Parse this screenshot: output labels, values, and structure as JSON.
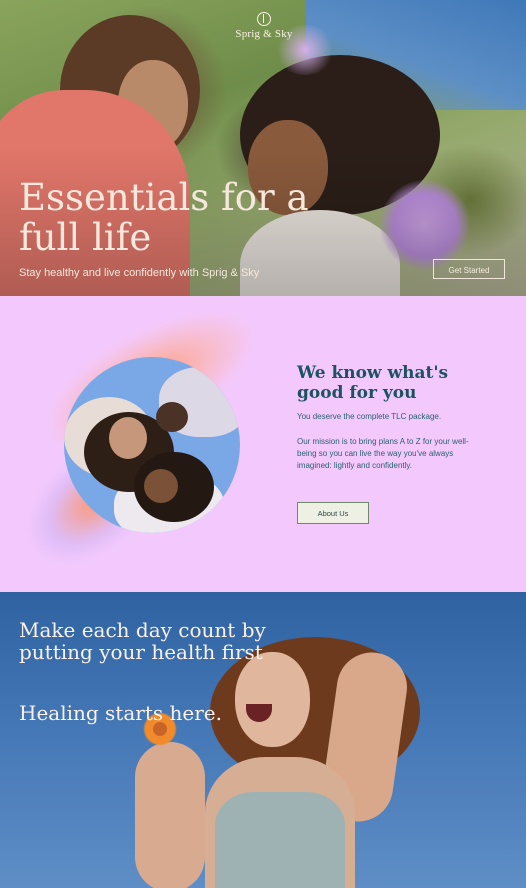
{
  "brand": {
    "name": "Sprig & Sky",
    "logo_icon": "sprig-leaf-icon"
  },
  "hero": {
    "title": "Essentials for a full life",
    "subtitle": "Stay healthy and live confidently with Sprig & Sky",
    "cta_label": "Get Started"
  },
  "about": {
    "heading": "We know what's good for you",
    "paragraph1": "You deserve the complete TLC package.",
    "paragraph2": "Our mission is to bring plans A to Z for your well-being so you can live the way you've always imagined: lightly and confidently.",
    "cta_label": "About Us"
  },
  "motto": {
    "heading": "Make each day count by putting your health first",
    "subheading": "Healing starts here."
  },
  "colors": {
    "hero_text": "#f6e8dc",
    "about_bg": "#f3c9fd",
    "about_heading": "#1c5360",
    "about_text": "#2b5f74",
    "motto_bg": "#3f6fa6"
  }
}
